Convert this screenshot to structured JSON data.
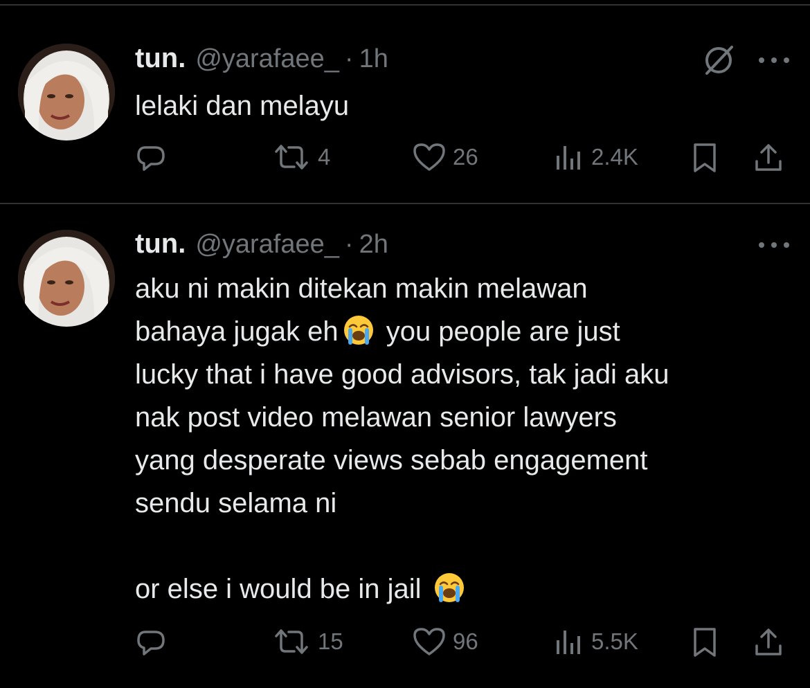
{
  "tweets": [
    {
      "display_name": "tun.",
      "handle": "@yarafaee_",
      "separator": "·",
      "time": "1h",
      "text": "lelaki dan melayu",
      "stats": {
        "replies": "",
        "retweets": "4",
        "likes": "26",
        "views": "2.4K"
      }
    },
    {
      "display_name": "tun.",
      "handle": "@yarafaee_",
      "separator": "·",
      "time": "2h",
      "text_parts": {
        "part1": "aku ni makin ditekan makin melawan\nbahaya jugak eh",
        "part2": " you people are just\nlucky that i have good advisors, tak jadi aku\nnak post video melawan senior lawyers\nyang desperate views sebab engagement\nsendu selama ni\n\nor else i would be in jail "
      },
      "stats": {
        "replies": "",
        "retweets": "15",
        "likes": "96",
        "views": "5.5K"
      }
    }
  ],
  "icons": {
    "reply": "reply-icon",
    "retweet": "retweet-icon",
    "like": "heart-icon",
    "views": "views-icon",
    "bookmark": "bookmark-icon",
    "share": "share-icon",
    "more": "more-icon",
    "grok": "grok-icon",
    "emoji": "loudly-crying-face-emoji"
  },
  "colors": {
    "background": "#000000",
    "text": "#e7e9ea",
    "muted": "#71767b",
    "divider": "#2f3336"
  }
}
